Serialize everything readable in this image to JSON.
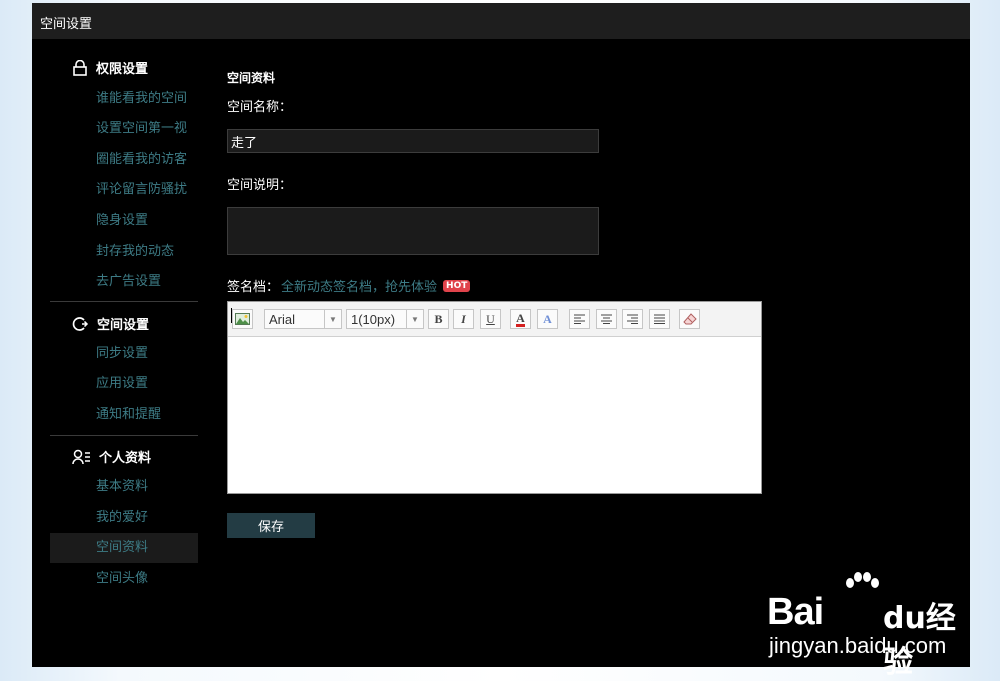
{
  "header": {
    "title": "空间设置"
  },
  "sidebar": {
    "sections": [
      {
        "title": "权限设置",
        "icon": "lock-icon",
        "items": [
          "谁能看我的空间",
          "设置空间第一视",
          "圈能看我的访客",
          "评论留言防骚扰",
          "隐身设置",
          "封存我的动态",
          "去广告设置"
        ]
      },
      {
        "title": "空间设置",
        "icon": "space-settings-icon",
        "items": [
          "同步设置",
          "应用设置",
          "通知和提醒"
        ]
      },
      {
        "title": "个人资料",
        "icon": "profile-icon",
        "items": [
          "基本资料",
          "我的爱好",
          "空间资料",
          "空间头像"
        ]
      }
    ],
    "active_item": "空间资料"
  },
  "form": {
    "title": "空间资料",
    "name_label": "空间名称：",
    "name_value": "走了",
    "desc_label": "空间说明：",
    "desc_value": "",
    "signature_label": "签名档：",
    "signature_promo": "全新动态签名档，抢先体验",
    "hot_badge": "HOT",
    "save_label": "保存"
  },
  "editor": {
    "font_family": "Arial",
    "font_size": "1(10px)",
    "bold_glyph": "B",
    "italic_glyph": "I",
    "underline_glyph": "U",
    "font_color_glyph": "A",
    "highlight_glyph": "A",
    "content": ""
  },
  "watermark": {
    "brand": "Bai",
    "du": "du",
    "jingyan": "经验",
    "url": "jingyan.baidu.com"
  },
  "colors": {
    "accent": "#3d7b85",
    "save_button": "#233c44",
    "hot": "#e0434b",
    "panel": "#000000"
  }
}
